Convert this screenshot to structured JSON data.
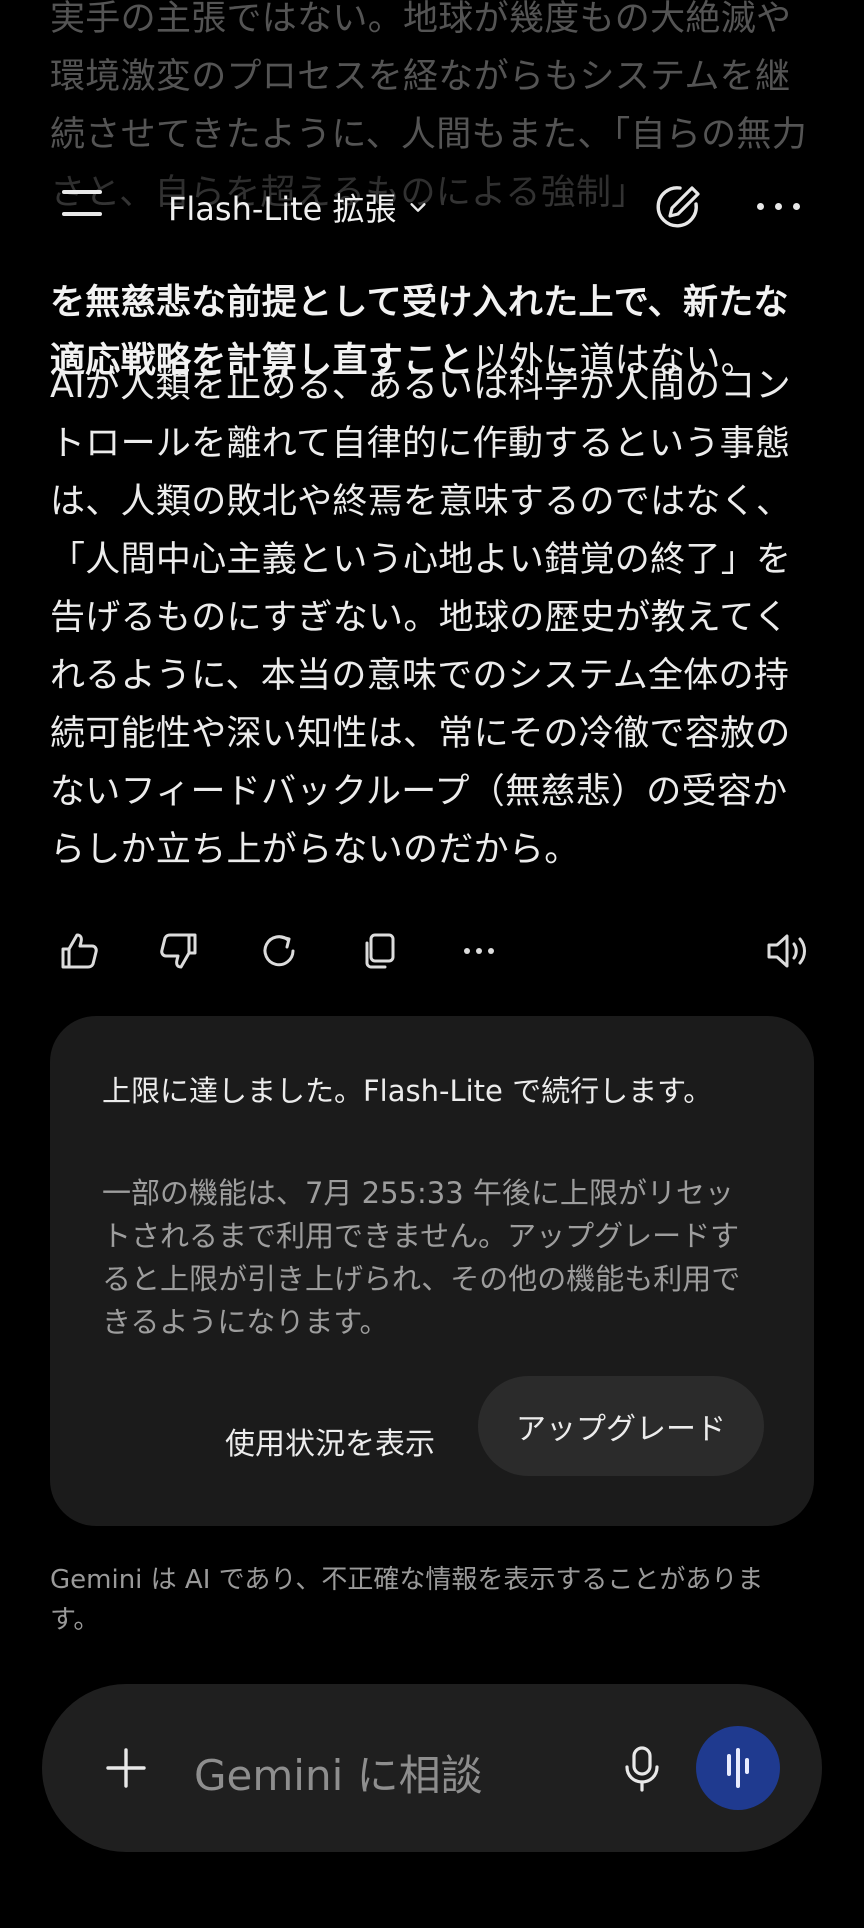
{
  "message": {
    "para1_faded": "実手の主張ではない。地球が幾度もの大絶滅や環境激変のプロセスを経ながらもシステムを継続させてきたように、人間もまた、「自らの無力さと、自らを超えるものによる強制」",
    "para1_tail_bold1": "を無慈悲な前提として受け入れた上で、新たな",
    "para1_tail_bold2": "適応戦略を計算し直すこと",
    "para1_tail_rest": "以外に道はない。",
    "para2": "AIが人類を止める、あるいは科学が人間のコントロールを離れて自律的に作動するという事態は、人類の敗北や終焉を意味するのではなく、「人間中心主義という心地よい錯覚の終了」を告げるものにすぎない。地球の歴史が教えてくれるように、本当の意味でのシステム全体の持続可能性や深い知性は、常にその冷徹で容赦のないフィードバックループ（無慈悲）の受容からしか立ち上がらないのだから。"
  },
  "header": {
    "model_label": "Flash-Lite 拡張",
    "icons": [
      "menu-icon",
      "chevron-down-icon",
      "edit-icon",
      "more-icon"
    ]
  },
  "actions": {
    "icons": [
      "thumbs-up-icon",
      "thumbs-down-icon",
      "regenerate-icon",
      "copy-icon",
      "more-icon",
      "speaker-icon"
    ]
  },
  "limit_card": {
    "title": "上限に達しました。Flash-Lite で続行します。",
    "body": "一部の機能は、7月 255:33 午後に上限がリセットされるまで利用できません。アップグレードすると上限が引き上げられ、その他の機能も利用できるようになります。",
    "usage_button": "使用状況を表示",
    "upgrade_button": "アップグレード"
  },
  "disclaimer": "Gemini は AI であり、不正確な情報を表示することがあります。",
  "input": {
    "placeholder": "Gemini に相談",
    "icons": [
      "plus-icon",
      "mic-icon",
      "live-icon"
    ]
  },
  "colors": {
    "background": "#000000",
    "card": "#1b1b1b",
    "input_bar": "#1f1f1f",
    "live_button": "#1f3a8f",
    "upgrade_button": "#2b2b2b"
  }
}
